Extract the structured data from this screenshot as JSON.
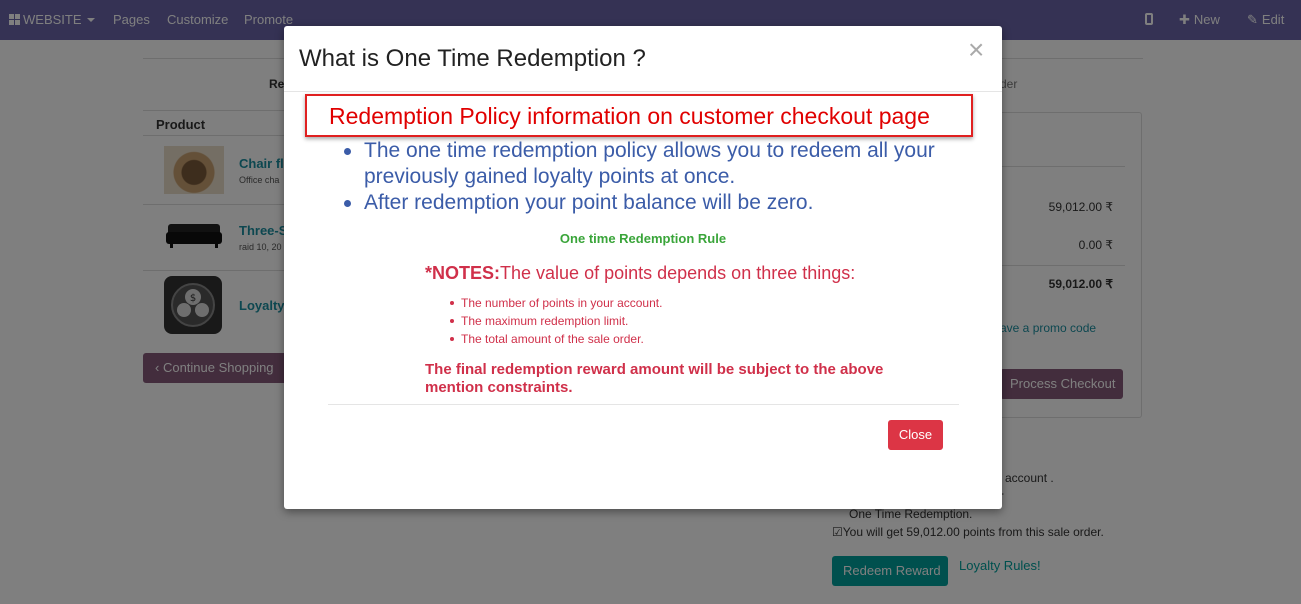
{
  "navbar": {
    "website_label": "WEBSITE",
    "pages_label": "Pages",
    "customize_label": "Customize",
    "promote_label": "Promote",
    "new_label": "New",
    "edit_label": "Edit"
  },
  "background": {
    "wizard_left": "Re",
    "wizard_right": "der",
    "table_header": "Product",
    "products": [
      {
        "name": "Chair fl",
        "sub": "Office cha"
      },
      {
        "name": "Three-S",
        "sub": "raid 10, 20"
      },
      {
        "name": "Loyalty",
        "sub": ""
      }
    ],
    "continue_label": "Continue Shopping",
    "amounts": [
      "59,012.00 ₹",
      "0.00 ₹",
      "59,012.00 ₹"
    ],
    "promo_label": "ave a promo code",
    "checkout_label": "Process Checkout",
    "loyalty_text_1": "account .",
    "loyalty_text_2": "-",
    "loyalty_text_3": "One Time Redemption.",
    "loyalty_text_4": "☑You will get 59,012.00 points from this sale order.",
    "redeem_label": "Redeem Reward",
    "rules_label": "Loyalty Rules!"
  },
  "modal": {
    "title": "What is One Time Redemption ?",
    "close_symbol": "×",
    "callout": "Redemption Policy information on customer checkout page",
    "policy_items": [
      "The one time redemption policy allows you to redeem all your previously gained loyalty points at once.",
      "After redemption your point balance will be zero."
    ],
    "rule_title": "One time Redemption Rule",
    "notes_prefix": "*NOTES:",
    "notes_text": "The value of points depends on three things:",
    "notes_items": [
      "The number of points in your account.",
      "The maximum redemption limit.",
      "The total amount of the sale order."
    ],
    "final_text": "The final redemption reward amount will be subject to the above mention constraints.",
    "close_button": "Close"
  },
  "colors": {
    "navbar": "#6a65a8",
    "primary": "#875a7b",
    "teal": "#00a09d",
    "danger": "#dc3545",
    "policy_blue": "#3b5ca8",
    "rule_green": "#3aa53a",
    "notes_red": "#d0304a"
  }
}
